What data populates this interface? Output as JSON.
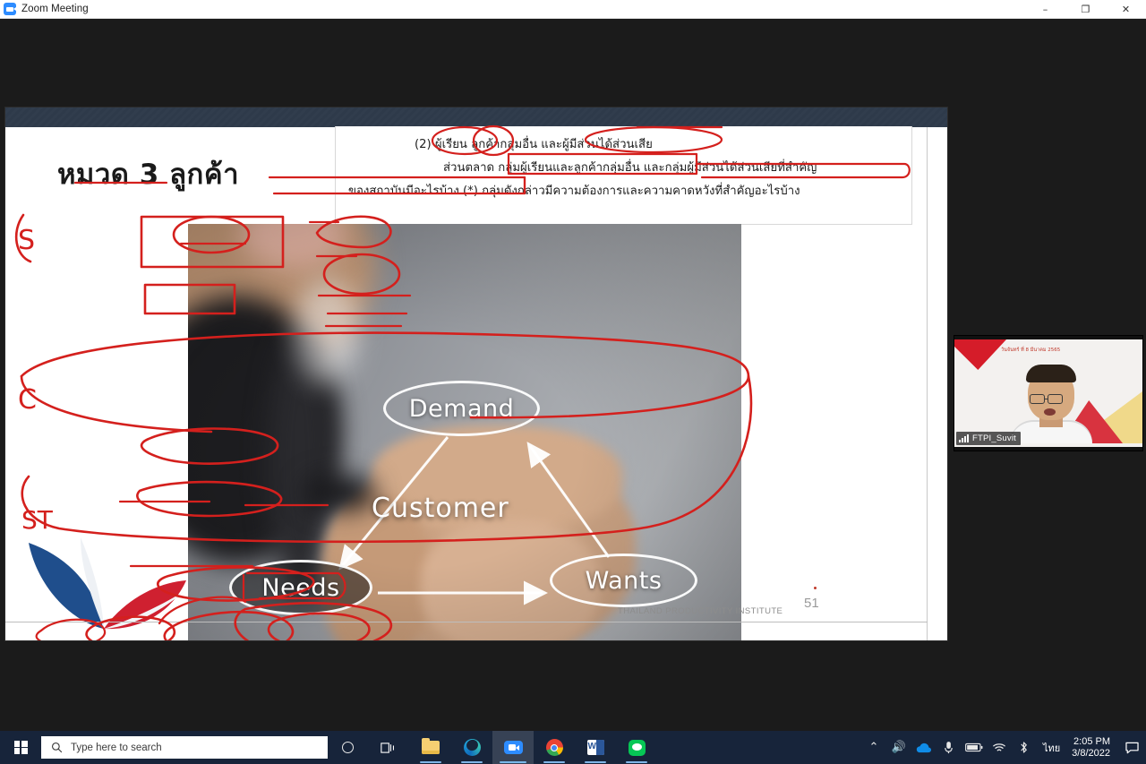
{
  "window": {
    "title": "Zoom Meeting",
    "app_icon": "zoom-camera-icon",
    "controls": {
      "minimize": "–",
      "restore": "❐",
      "close": "✕"
    }
  },
  "slide": {
    "title": "หมวด 3 ลูกค้า",
    "question_lines": [
      "(2)  ผู้เรียน ลูกค้ากลุ่มอื่น และผู้มีส่วนได้ส่วนเสีย",
      "ส่วนตลาด กลุ่มผู้เรียนและลูกค้ากลุ่มอื่น และกลุ่มผู้มีส่วนได้ส่วนเสียที่สำคัญ",
      "ของสถาบันมีอะไรบ้าง (*) กลุ่มดังกล่าวมีความต้องการและความคาดหวังที่สำคัญอะไรบ้าง"
    ],
    "diagram": {
      "center_label": "Customer",
      "nodes": [
        {
          "id": "demand",
          "label": "Demand"
        },
        {
          "id": "needs",
          "label": "Needs"
        },
        {
          "id": "wants",
          "label": "Wants"
        }
      ]
    },
    "footer_text": "THAILAND PRODUCTIVITY INSTITUTE",
    "page_number": "51",
    "logo_name": "ftpi-logo",
    "annotation_letters": [
      "S",
      "C",
      "ST"
    ],
    "annotation_color": "#d4201d"
  },
  "video_tile": {
    "participant_name": "FTPI_Suvit",
    "status_icon": "signal-bars-icon"
  },
  "taskbar": {
    "start_label": "windows-start",
    "search_placeholder": "Type here to search",
    "search_value": "",
    "cortana_label": "cortana",
    "task_view_label": "task-view",
    "apps": [
      {
        "name": "file-explorer",
        "label": "File Explorer",
        "active": false
      },
      {
        "name": "microsoft-edge",
        "label": "Microsoft Edge",
        "active": false
      },
      {
        "name": "zoom",
        "label": "Zoom Meeting",
        "active": true
      },
      {
        "name": "google-chrome",
        "label": "Google Chrome",
        "active": false
      },
      {
        "name": "microsoft-word",
        "label": "Microsoft Word",
        "active": false
      },
      {
        "name": "line",
        "label": "LINE",
        "active": false
      }
    ],
    "tray_icons": [
      "show-hidden-icons",
      "volume-icon",
      "onedrive-icon",
      "microphone-icon",
      "battery-icon",
      "wifi-icon",
      "bluetooth-icon"
    ],
    "language": "ไทย",
    "time": "2:05 PM",
    "date": "3/8/2022",
    "action_center_label": "action-center"
  }
}
